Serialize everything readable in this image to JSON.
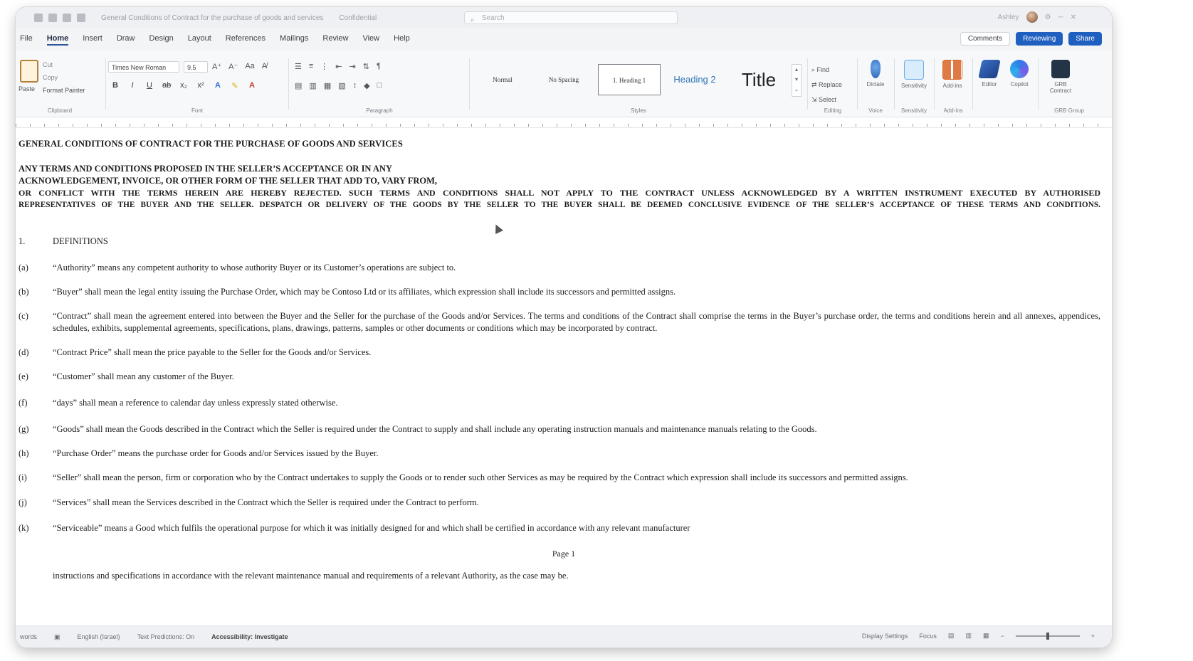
{
  "titlebar": {
    "doc_title": "General Conditions of Contract for the purchase of goods and services",
    "badge": "Confidential",
    "search_placeholder": "Search",
    "user_name": "Ashley"
  },
  "menubar": {
    "tabs": [
      "File",
      "Home",
      "Insert",
      "Draw",
      "Design",
      "Layout",
      "References",
      "Mailings",
      "Review",
      "View",
      "Help"
    ],
    "active_tab": "Home",
    "comments": "Comments",
    "reviewing": "Reviewing",
    "share": "Share"
  },
  "ribbon": {
    "clipboard": {
      "paste": "Paste",
      "cut": "Cut",
      "copy": "Copy",
      "format_painter": "Format Painter",
      "label": "Clipboard"
    },
    "font": {
      "family": "Times New Roman",
      "size": "9.5",
      "label": "Font"
    },
    "paragraph": {
      "label": "Paragraph"
    },
    "styles": {
      "normal": "Normal",
      "no_spacing": "No Spacing",
      "heading1": "1.  Heading 1",
      "heading2": "Heading 2",
      "title": "Title",
      "label": "Styles"
    },
    "editing": {
      "find": "Find",
      "replace": "Replace",
      "select": "Select",
      "label": "Editing"
    },
    "voice": {
      "dictate": "Dictate",
      "label": "Voice"
    },
    "sensitivity": {
      "name": "Sensitivity",
      "label": "Sensitivity"
    },
    "addins": {
      "name": "Add-ins",
      "label": "Add-ins"
    },
    "editor": "Editor",
    "copilot": "Copilot",
    "contract": {
      "name": "GRB Contract",
      "label": "GRB Group"
    }
  },
  "document": {
    "heading": "GENERAL CONDITIONS OF CONTRACT FOR THE PURCHASE OF GOODS AND SERVICES",
    "intro_line1": "ANY TERMS AND CONDITIONS PROPOSED IN THE SELLER’S ACCEPTANCE OR IN ANY",
    "intro_line2": "ACKNOWLEDGEMENT, INVOICE, OR OTHER FORM OF THE SELLER THAT ADD TO, VARY FROM,",
    "intro_line3": "OR CONFLICT WITH THE TERMS HEREIN ARE HEREBY REJECTED. SUCH TERMS AND CONDITIONS SHALL NOT APPLY TO THE CONTRACT UNLESS ACKNOWLEDGED BY A WRITTEN INSTRUMENT EXECUTED BY AUTHORISED",
    "intro_line4": "REPRESENTATIVES OF THE BUYER AND THE SELLER. DESPATCH OR DELIVERY OF THE GOODS BY THE SELLER TO THE BUYER SHALL BE DEEMED CONCLUSIVE EVIDENCE OF THE SELLER’S ACCEPTANCE OF THESE TERMS AND CONDITIONS.",
    "section_num": "1.",
    "section_title": "DEFINITIONS",
    "definitions": [
      {
        "label": "(a)",
        "text": "“Authority” means any competent authority to whose authority Buyer or its Customer’s operations are subject to."
      },
      {
        "label": "(b)",
        "text": "“Buyer” shall mean the legal entity issuing the Purchase Order, which may be Contoso Ltd or its affiliates, which expression shall include its successors and permitted assigns."
      },
      {
        "label": "(c)",
        "text": "“Contract” shall mean the agreement entered into between the Buyer and the Seller for the purchase of the Goods and/or Services. The terms and conditions of the Contract shall comprise the terms in the Buyer’s purchase order, the terms and conditions herein and all annexes, appendices, schedules, exhibits, supplemental agreements, specifications, plans, drawings, patterns, samples or other documents or conditions which may be incorporated by contract."
      },
      {
        "label": "(d)",
        "text": "“Contract Price” shall mean the price payable to the Seller for the Goods and/or Services."
      },
      {
        "label": "(e)",
        "text": "“Customer” shall mean any customer of the Buyer."
      },
      {
        "label": "(f)",
        "text": "“days” shall mean a reference to calendar day unless expressly stated otherwise."
      },
      {
        "label": "(g)",
        "text": "“Goods” shall mean the Goods described in the Contract which the Seller is required under the Contract to supply and shall include any operating instruction manuals and maintenance manuals relating to the Goods."
      },
      {
        "label": "(h)",
        "text": "“Purchase Order” means the purchase order for Goods and/or Services issued by the Buyer."
      },
      {
        "label": "(i)",
        "text": "“Seller” shall mean the person, firm or corporation who by the Contract undertakes to supply the Goods or to render such other Services as may be required by the Contract which expression shall include its successors and permitted assigns."
      },
      {
        "label": "(j)",
        "text": "“Services” shall mean the Services described in the Contract which the Seller is required under the Contract to perform."
      },
      {
        "label": "(k)",
        "text": "“Serviceable” means a Good which fulfils the operational purpose for which it was initially designed for and which shall be certified in accordance with any relevant manufacturer"
      }
    ],
    "page_label": "Page 1",
    "continuation": "instructions and specifications in accordance with the relevant maintenance manual and requirements of a relevant Authority, as the case may be."
  },
  "statusbar": {
    "words": "words",
    "language": "English (Israel)",
    "text_predictions": "Text Predictions: On",
    "accessibility": "Accessibility: Investigate",
    "display_settings": "Display Settings",
    "focus": "Focus"
  },
  "zoom_level": 0.5
}
